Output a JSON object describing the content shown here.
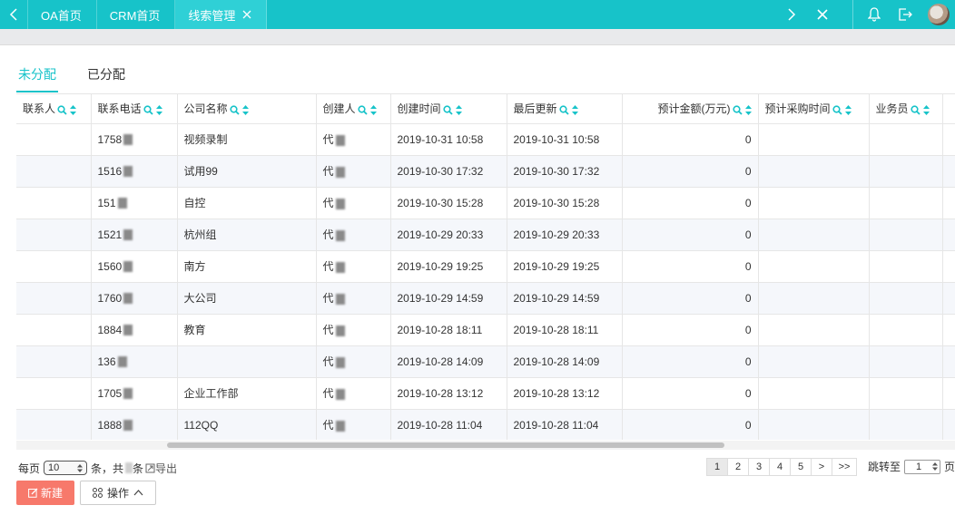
{
  "tabs": [
    {
      "label": "OA首页"
    },
    {
      "label": "CRM首页"
    },
    {
      "label": "线索管理"
    }
  ],
  "subtabs": [
    {
      "label": "未分配"
    },
    {
      "label": "已分配"
    }
  ],
  "columns": [
    "联系人",
    "联系电话",
    "公司名称",
    "创建人",
    "创建时间",
    "最后更新",
    "预计金额(万元)",
    "预计采购时间",
    "业务员"
  ],
  "rows": [
    {
      "contact": "",
      "phone": "1758",
      "company": "视频录制",
      "creator": "代",
      "created": "2019-10-31 10:58",
      "updated": "2019-10-31 10:58",
      "amount": "0",
      "purchase": "",
      "sales": ""
    },
    {
      "contact": "",
      "phone": "1516",
      "company": "试用99",
      "creator": "代",
      "created": "2019-10-30 17:32",
      "updated": "2019-10-30 17:32",
      "amount": "0",
      "purchase": "",
      "sales": ""
    },
    {
      "contact": "",
      "phone": "151",
      "company": "自控",
      "creator": "代",
      "created": "2019-10-30 15:28",
      "updated": "2019-10-30 15:28",
      "amount": "0",
      "purchase": "",
      "sales": ""
    },
    {
      "contact": "",
      "phone": "1521",
      "company": "杭州组",
      "creator": "代",
      "created": "2019-10-29 20:33",
      "updated": "2019-10-29 20:33",
      "amount": "0",
      "purchase": "",
      "sales": ""
    },
    {
      "contact": "",
      "phone": "1560",
      "company": "南方",
      "creator": "代",
      "created": "2019-10-29 19:25",
      "updated": "2019-10-29 19:25",
      "amount": "0",
      "purchase": "",
      "sales": ""
    },
    {
      "contact": "",
      "phone": "1760",
      "company": "大公司",
      "creator": "代",
      "created": "2019-10-29 14:59",
      "updated": "2019-10-29 14:59",
      "amount": "0",
      "purchase": "",
      "sales": ""
    },
    {
      "contact": "",
      "phone": "1884",
      "company": "教育",
      "creator": "代",
      "created": "2019-10-28 18:11",
      "updated": "2019-10-28 18:11",
      "amount": "0",
      "purchase": "",
      "sales": ""
    },
    {
      "contact": "",
      "phone": "136",
      "company": "",
      "creator": "代",
      "created": "2019-10-28 14:09",
      "updated": "2019-10-28 14:09",
      "amount": "0",
      "purchase": "",
      "sales": ""
    },
    {
      "contact": "",
      "phone": "1705",
      "company": "企业工作部",
      "creator": "代",
      "created": "2019-10-28 13:12",
      "updated": "2019-10-28 13:12",
      "amount": "0",
      "purchase": "",
      "sales": ""
    },
    {
      "contact": "",
      "phone": "1888",
      "company": "112QQ",
      "creator": "代",
      "created": "2019-10-28 11:04",
      "updated": "2019-10-28 11:04",
      "amount": "0",
      "purchase": "",
      "sales": ""
    }
  ],
  "footer": {
    "per_page_label": "每页",
    "page_size": "10",
    "count_text": "条，共",
    "count_suffix": "条",
    "export_label": "导出",
    "pages": [
      "1",
      "2",
      "3",
      "4",
      "5",
      ">",
      ">>"
    ],
    "jump_label": "跳转至",
    "jump_value": "1",
    "page_unit": "页"
  },
  "actions": {
    "new_label": "新建",
    "op_label": "操作"
  },
  "colors": {
    "accent": "#17c3c9",
    "new_button": "#f7796b"
  }
}
